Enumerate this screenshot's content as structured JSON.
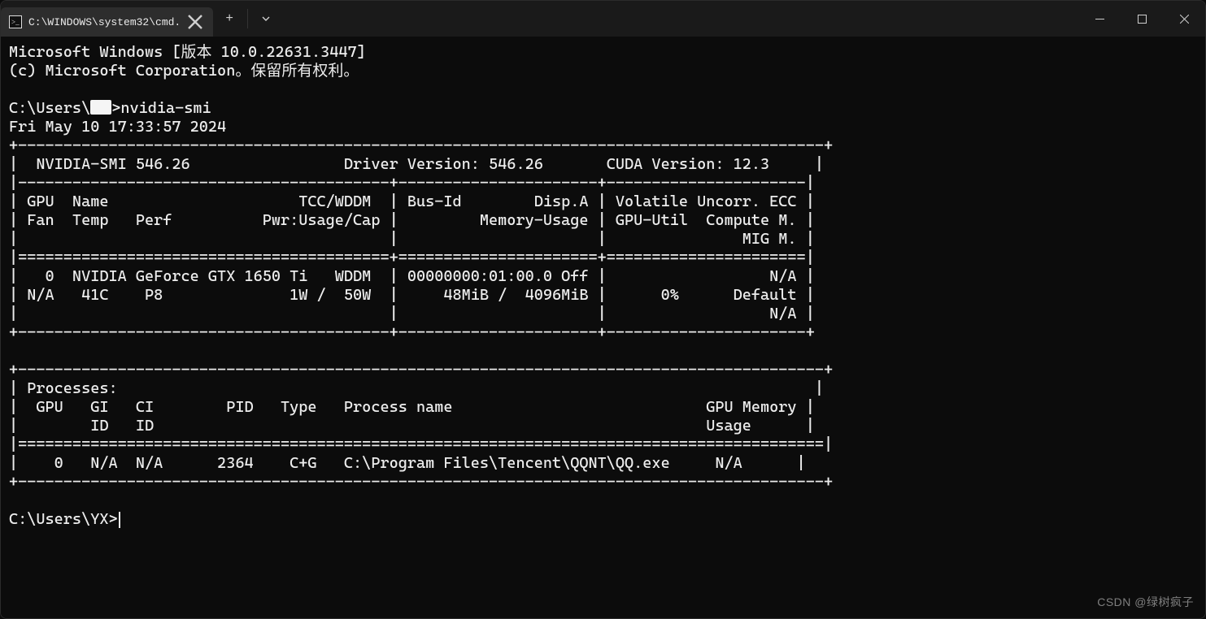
{
  "titlebar": {
    "tab_title": "C:\\WINDOWS\\system32\\cmd.",
    "newtab_label": "+",
    "dropdown_label": "⌄"
  },
  "terminal": {
    "banner_line1": "Microsoft Windows [版本 10.0.22631.3447]",
    "banner_line2": "(c) Microsoft Corporation。保留所有权利。",
    "prompt1_prefix": "C:\\Users\\",
    "prompt1_suffix": ">",
    "command1": "nvidia-smi",
    "timestamp": "Fri May 10 17:33:57 2024",
    "smi": {
      "header": "|  NVIDIA-SMI 546.26                 Driver Version: 546.26       CUDA Version: 12.3     |",
      "nvidia_smi_version": "546.26",
      "driver_version": "546.26",
      "cuda_version": "12.3",
      "cols_line1": "| GPU  Name                     TCC/WDDM  | Bus-Id        Disp.A | Volatile Uncorr. ECC |",
      "cols_line2": "| Fan  Temp   Perf          Pwr:Usage/Cap |         Memory-Usage | GPU-Util  Compute M. |",
      "cols_line3": "|                                         |                      |               MIG M. |",
      "gpu_line1": "|   0  NVIDIA GeForce GTX 1650 Ti   WDDM  | 00000000:01:00.0 Off |                  N/A |",
      "gpu_line2": "| N/A   41C    P8              1W /  50W  |     48MiB /  4096MiB |      0%      Default |",
      "gpu_line3": "|                                         |                      |                  N/A |",
      "gpu": {
        "index": 0,
        "name": "NVIDIA GeForce GTX 1650 Ti",
        "mode": "WDDM",
        "bus_id": "00000000:01:00.0",
        "disp_a": "Off",
        "ecc": "N/A",
        "fan": "N/A",
        "temp": "41C",
        "perf": "P8",
        "pwr_usage": "1W",
        "pwr_cap": "50W",
        "mem_used": "48MiB",
        "mem_total": "4096MiB",
        "gpu_util": "0%",
        "compute_m": "Default",
        "mig_m": "N/A"
      },
      "proc_header": "| Processes:                                                                             |",
      "proc_cols1": "|  GPU   GI   CI        PID   Type   Process name                            GPU Memory |",
      "proc_cols2": "|        ID   ID                                                             Usage      |",
      "proc_row1": "|    0   N/A  N/A      2364    C+G   C:\\Program Files\\Tencent\\QQNT\\QQ.exe     N/A      |",
      "process": {
        "gpu": 0,
        "gi_id": "N/A",
        "ci_id": "N/A",
        "pid": 2364,
        "type": "C+G",
        "name": "C:\\Program Files\\Tencent\\QQNT\\QQ.exe",
        "mem": "N/A"
      }
    },
    "prompt2": "C:\\Users\\YX>"
  },
  "box": {
    "top": "+-----------------------------------------+----------------------+----------------------+",
    "sep_eq": "|=========================================+======================+======================|",
    "bot": "+-----------------------------------------+----------------------+----------------------+",
    "hr_long": "+-----------------------------------------------------------------------------------------+",
    "hr_thin": "|-----------------------------------------+----------------------+----------------------|",
    "row_blank": "|                                                                                         |",
    "sep_eq2": "|=========================================================================================|"
  },
  "watermark": "CSDN @绿树疯子"
}
